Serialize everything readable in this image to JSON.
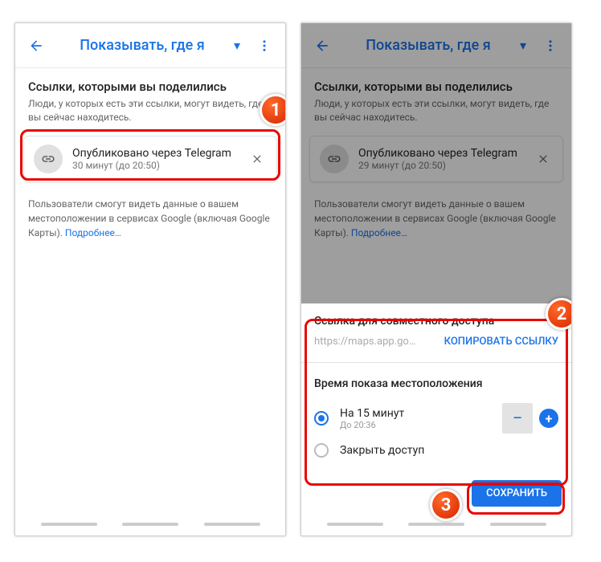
{
  "left": {
    "header": {
      "title": "Показывать, где я"
    },
    "links_section": {
      "title": "Ссылки, которыми вы поделились",
      "subtitle": "Люди, у которых есть эти ссылки, могут видеть, где вы сейчас находитесь."
    },
    "card": {
      "title": "Опубликовано через Telegram",
      "sub": "30 минут (до 20:50)"
    },
    "info": {
      "text": "Пользователи смогут видеть данные о вашем местоположении в сервисах Google (включая Google Карты). ",
      "more": "Подробнее…"
    }
  },
  "right": {
    "header": {
      "title": "Показывать, где я"
    },
    "links_section": {
      "title": "Ссылки, которыми вы поделились",
      "subtitle": "Люди, у которых есть эти ссылки, могут видеть, где вы сейчас находитесь."
    },
    "card": {
      "title": "Опубликовано через Telegram",
      "sub": "29 минут (до 20:50)"
    },
    "info": {
      "text": "Пользователи смогут видеть данные о вашем местоположении в сервисах Google (включая Google Карты). ",
      "more": "Подробнее…"
    },
    "sheet": {
      "share_title": "Ссылка для совместного доступа",
      "share_url": "https://maps.app.go…",
      "copy": "КОПИРОВАТЬ ССЫЛКУ",
      "time_title": "Время показа местоположения",
      "opt1": {
        "label": "На 15 минут",
        "sub": "До 20:36"
      },
      "opt2": {
        "label": "Закрыть доступ"
      },
      "save": "СОХРАНИТЬ"
    }
  }
}
